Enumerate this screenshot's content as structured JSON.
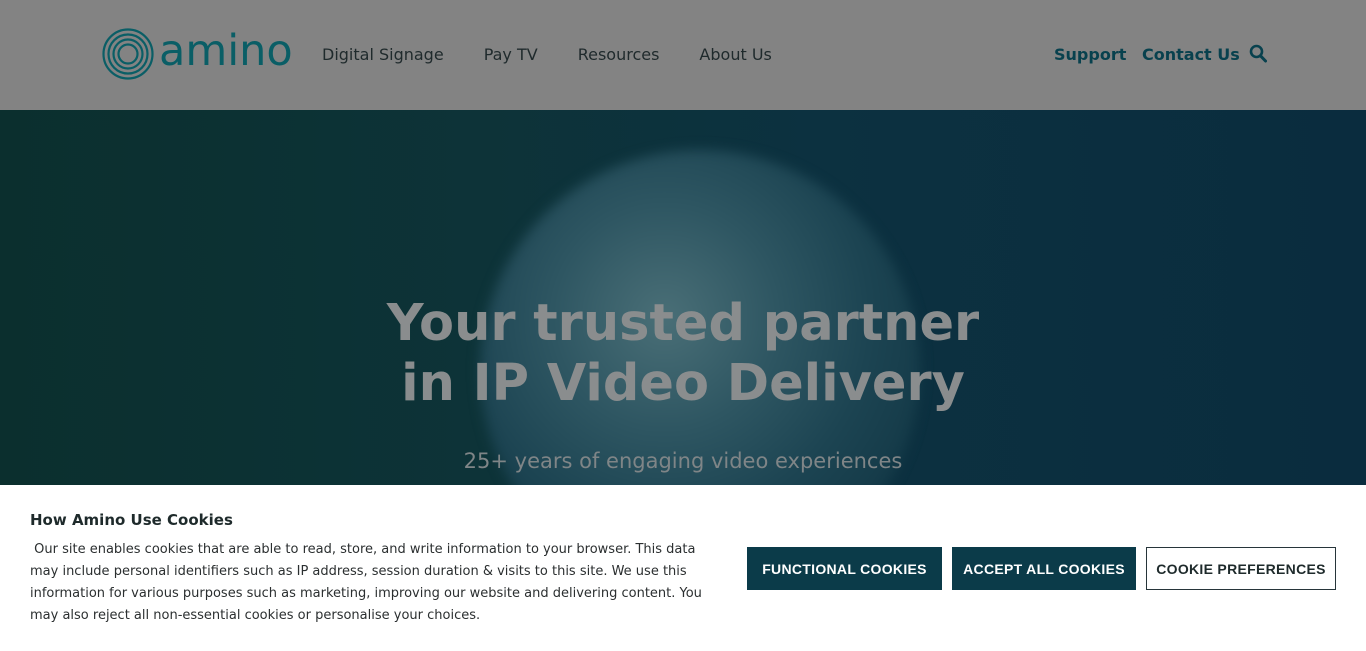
{
  "brand": {
    "name": "amino",
    "color": "#0a5e66"
  },
  "nav": {
    "items": [
      "Digital Signage",
      "Pay TV",
      "Resources",
      "About Us"
    ]
  },
  "utility": {
    "support": "Support",
    "contact": "Contact Us",
    "search_icon": "search-icon"
  },
  "hero": {
    "title_line1": "Your trusted partner",
    "title_line2": "in IP Video Delivery",
    "subtitle": "25+ years of engaging video experiences"
  },
  "cookie_banner": {
    "title": "How Amino Use Cookies",
    "text": " Our site enables cookies that are able to read, store, and write information to your browser. This data may include personal identifiers such as IP address, session duration & visits to this site. We use this information for various purposes such as marketing, improving our website and delivering content. You may also reject all non-essential cookies or personalise your choices.",
    "functional": "FUNCTIONAL COOKIES",
    "accept_all": "ACCEPT ALL COOKIES",
    "preferences": "COOKIE PREFERENCES"
  },
  "colors": {
    "header_overlay": "#838383",
    "button_dark": "#0b3b49",
    "link": "#08414e"
  }
}
